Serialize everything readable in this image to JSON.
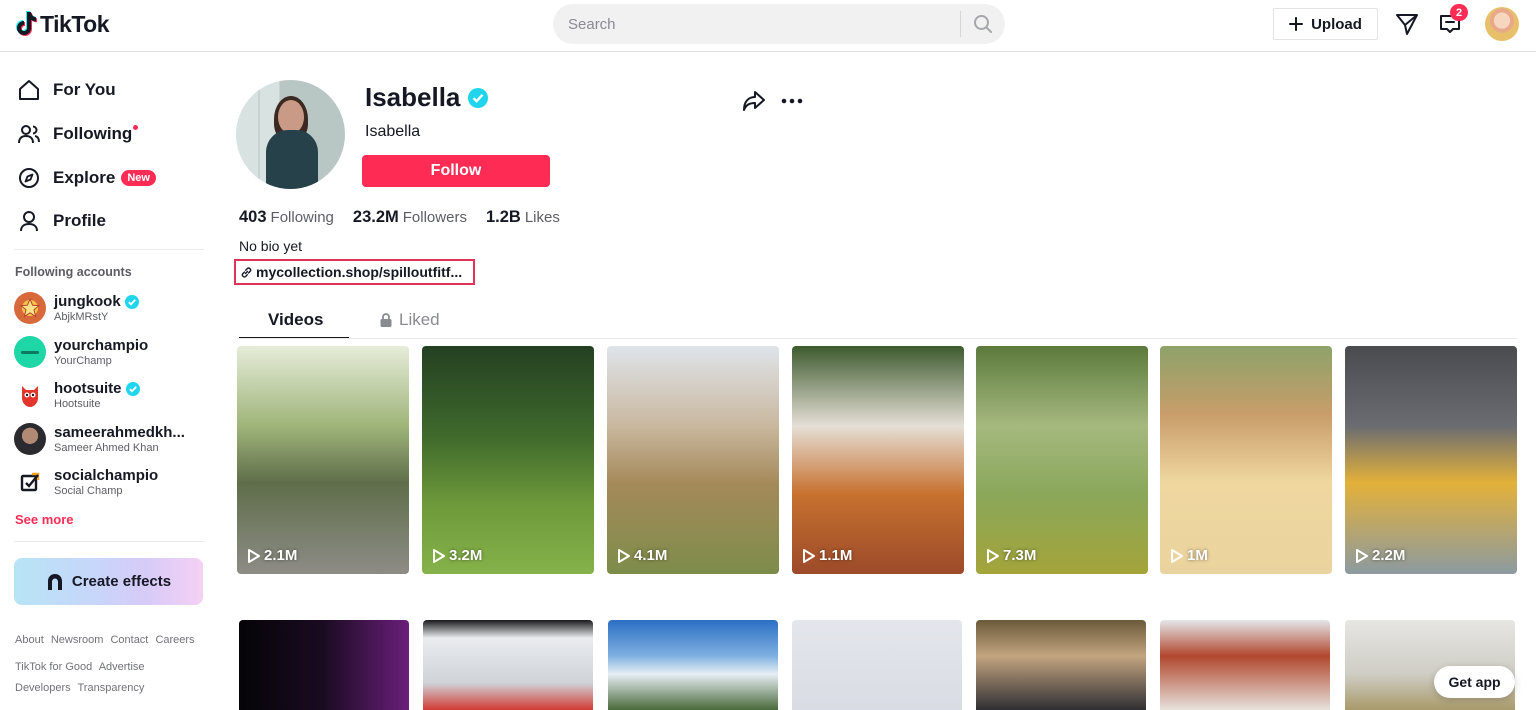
{
  "header": {
    "logo_text": "TikTok",
    "search_placeholder": "Search",
    "upload_label": "Upload",
    "inbox_badge": "2"
  },
  "sidebar": {
    "nav": [
      {
        "label": "For You",
        "icon": "home-icon"
      },
      {
        "label": "Following",
        "icon": "people-icon",
        "dot": true
      },
      {
        "label": "Explore",
        "icon": "compass-icon",
        "tag": "New"
      },
      {
        "label": "Profile",
        "icon": "person-icon"
      }
    ],
    "following_title": "Following accounts",
    "accounts": [
      {
        "name": "jungkook",
        "handle": "AbjkMRstY",
        "verified": true
      },
      {
        "name": "yourchampio",
        "handle": "YourChamp",
        "verified": false
      },
      {
        "name": "hootsuite",
        "handle": "Hootsuite",
        "verified": true
      },
      {
        "name": "sameerahmedkh...",
        "handle": "Sameer Ahmed Khan",
        "verified": false
      },
      {
        "name": "socialchampio",
        "handle": "Social Champ",
        "verified": false
      }
    ],
    "see_more": "See more",
    "create_effects": "Create effects",
    "footer_row1": [
      "About",
      "Newsroom",
      "Contact",
      "Careers"
    ],
    "footer_row2": [
      "TikTok for Good",
      "Advertise"
    ],
    "footer_row3": [
      "Developers",
      "Transparency"
    ]
  },
  "profile": {
    "username": "Isabella",
    "nickname": "Isabella",
    "follow_label": "Follow",
    "stats": {
      "following_count": "403",
      "following_label": "Following",
      "followers_count": "23.2M",
      "followers_label": "Followers",
      "likes_count": "1.2B",
      "likes_label": "Likes"
    },
    "bio": "No bio yet",
    "link": "mycollection.shop/spilloutfitf..."
  },
  "tabs": {
    "videos": "Videos",
    "liked": "Liked"
  },
  "videos": [
    {
      "views": "2.1M"
    },
    {
      "views": "3.2M"
    },
    {
      "views": "4.1M"
    },
    {
      "views": "1.1M"
    },
    {
      "views": "7.3M"
    },
    {
      "views": "1M"
    },
    {
      "views": "2.2M"
    }
  ],
  "get_app": "Get app",
  "colors": {
    "accent": "#fe2c55",
    "verified": "#20d5ec"
  }
}
